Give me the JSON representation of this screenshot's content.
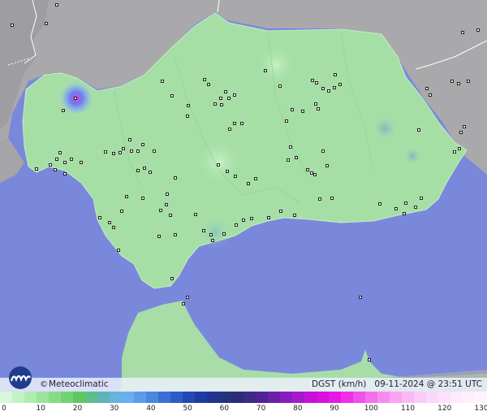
{
  "brand": {
    "copyright_symbol": "©",
    "name": "Meteoclimatic"
  },
  "info": {
    "variable": "DGST",
    "unit": "(km/h)",
    "timestamp": "09-11-2024 @ 23:51 UTC"
  },
  "scale": {
    "labels": [
      "0",
      "10",
      "20",
      "30",
      "40",
      "50",
      "60",
      "70",
      "80",
      "90",
      "100",
      "110",
      "120",
      "130"
    ],
    "colors": [
      "#d6f8d6",
      "#c4f2c4",
      "#b0ecb0",
      "#9be49b",
      "#86dc86",
      "#72d372",
      "#5ec85e",
      "#5cbf8a",
      "#5cb4b8",
      "#65b5dc",
      "#6aaef0",
      "#5a9ce8",
      "#4a88e0",
      "#3a70d4",
      "#2d5cc6",
      "#2448b4",
      "#1f3aa0",
      "#1e3490",
      "#24337c",
      "#2c2e74",
      "#3c2a86",
      "#4e2494",
      "#6a20a8",
      "#8a1cbe",
      "#a818cc",
      "#c412d8",
      "#d810e0",
      "#e818e4",
      "#ee30e8",
      "#f250ea",
      "#f470ec",
      "#f68cf0",
      "#f8a4f2",
      "#fab8f4",
      "#fccaf6",
      "#fcd8f8",
      "#fce2fa",
      "#fdeafb",
      "#fdf0fc",
      "#fef4fd"
    ]
  },
  "icons": {
    "logo": "meteoclimatic-logo-icon"
  }
}
